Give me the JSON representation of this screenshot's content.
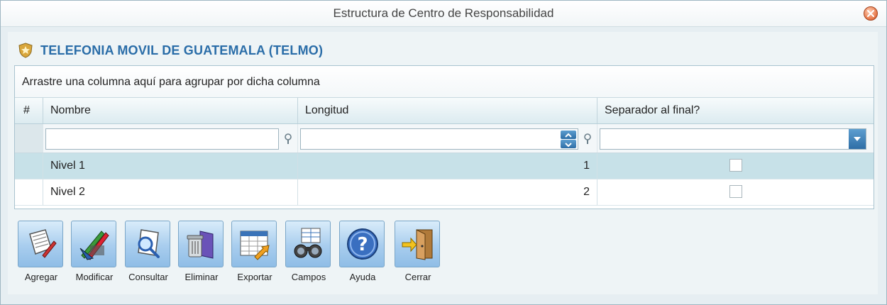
{
  "window": {
    "title": "Estructura de Centro de Responsabilidad"
  },
  "company": {
    "name": "TELEFONIA MOVIL DE GUATEMALA (TELMO)"
  },
  "grid": {
    "group_panel_text": "Arrastre una columna aquí para agrupar por dicha columna",
    "columns": [
      "#",
      "Nombre",
      "Longitud",
      "Separador al final?"
    ],
    "rows": [
      {
        "nombre": "Nivel 1",
        "longitud": "1",
        "separador": false,
        "selected": true
      },
      {
        "nombre": "Nivel 2",
        "longitud": "2",
        "separador": false,
        "selected": false
      }
    ]
  },
  "toolbar": {
    "buttons": [
      {
        "label": "Agregar",
        "icon": "add-document-icon"
      },
      {
        "label": "Modificar",
        "icon": "edit-pencils-icon"
      },
      {
        "label": "Consultar",
        "icon": "search-document-icon"
      },
      {
        "label": "Eliminar",
        "icon": "trash-icon"
      },
      {
        "label": "Exportar",
        "icon": "export-table-icon"
      },
      {
        "label": "Campos",
        "icon": "binoculars-icon"
      },
      {
        "label": "Ayuda",
        "icon": "help-icon"
      },
      {
        "label": "Cerrar",
        "icon": "exit-door-icon"
      }
    ]
  },
  "colors": {
    "accent": "#2a6da8",
    "selected_row": "#c7e1e8",
    "button_blue": "#a8cdee"
  }
}
